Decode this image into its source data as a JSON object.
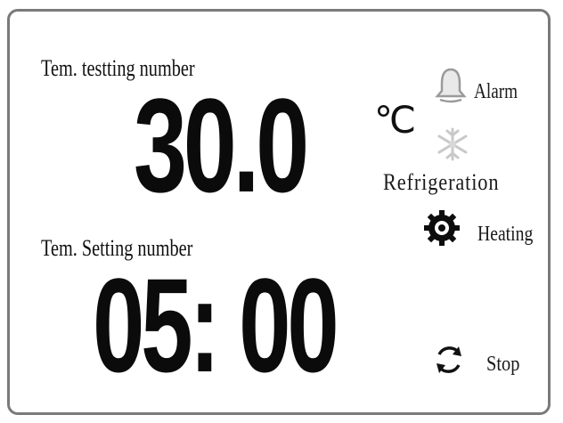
{
  "panel": {
    "current": {
      "label": "Tem. testting number",
      "value": "30.0",
      "unit": "℃"
    },
    "setting": {
      "label": "Tem. Setting number",
      "value": "05: 00"
    },
    "indicators": {
      "alarm": {
        "label": "Alarm",
        "icon": "bell-icon",
        "state": "inactive"
      },
      "refrigeration": {
        "label": "Refrigeration",
        "icon": "snowflake-icon",
        "state": "inactive"
      },
      "heating": {
        "label": "Heating",
        "icon": "gear-icon",
        "state": "active"
      },
      "stop": {
        "label": "Stop",
        "icon": "refresh-icon"
      }
    }
  },
  "colors": {
    "frame": "#7a7a7a",
    "text": "#111111",
    "inactive_icon": "#b8b8b8"
  }
}
